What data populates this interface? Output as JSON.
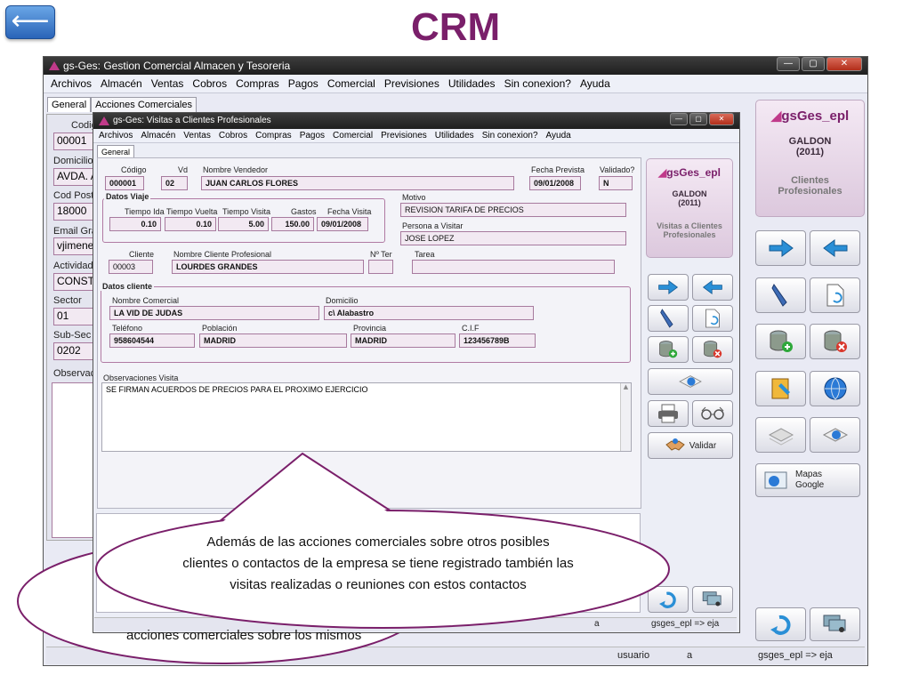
{
  "slide": {
    "title": "CRM",
    "back_label": "⟵"
  },
  "main_window": {
    "title": "gs-Ges: Gestion Comercial Almacen y Tesoreria",
    "menu": [
      "Archivos",
      "Almacén",
      "Ventas",
      "Cobros",
      "Compras",
      "Pagos",
      "Comercial",
      "Previsiones",
      "Utilidades",
      "Sin conexion?",
      "Ayuda"
    ],
    "tabs": [
      "General",
      "Acciones Comerciales"
    ],
    "left_fields": [
      {
        "label": "Codig",
        "value": "00001"
      },
      {
        "label": "Domicilio",
        "value": "AVDA. A"
      },
      {
        "label": "Cod Posta",
        "value": "18000"
      },
      {
        "label": "Email Gra",
        "value": "vjimene"
      },
      {
        "label": "Actividad",
        "value": "CONST"
      },
      {
        "label": "Sector",
        "value": "01"
      },
      {
        "label": "Sub-Sec",
        "value": "0202"
      },
      {
        "label": "Observac",
        "value": ""
      }
    ],
    "brand": {
      "name": "gsGes_epl",
      "company": "GALDON",
      "year": "(2011)",
      "caption": "Clientes Profesionales"
    },
    "maps_button": "Mapas Google",
    "status": {
      "user_label": "usuario",
      "user": "a",
      "session": "gsges_epl => eja"
    }
  },
  "dialog": {
    "title": "gs-Ges: Visitas a Clientes Profesionales",
    "menu": [
      "Archivos",
      "Almacén",
      "Ventas",
      "Cobros",
      "Compras",
      "Pagos",
      "Comercial",
      "Previsiones",
      "Utilidades",
      "Sin conexion?",
      "Ayuda"
    ],
    "tab": "General",
    "labels": {
      "codigo": "Código",
      "vd": "Vd",
      "vendedor": "Nombre Vendedor",
      "fecha_prevista": "Fecha Prevista",
      "validado": "Validado?",
      "datos_viaje": "Datos Viaje",
      "tiempo_ida": "Tiempo Ida",
      "tiempo_vuelta": "Tiempo Vuelta",
      "tiempo_visita": "Tiempo Visita",
      "gastos": "Gastos",
      "fecha_visita": "Fecha Visita",
      "motivo": "Motivo",
      "persona": "Persona a Visitar",
      "cliente": "Cliente",
      "nombre_cliente": "Nombre Cliente Profesional",
      "n_ter": "Nº Ter",
      "tarea": "Tarea",
      "datos_cliente": "Datos cliente",
      "nombre_comercial": "Nombre Comercial",
      "domicilio": "Domicilio",
      "telefono": "Teléfono",
      "poblacion": "Población",
      "provincia": "Provincia",
      "cif": "C.I.F",
      "observaciones": "Observaciones Visita"
    },
    "values": {
      "codigo": "000001",
      "vd": "02",
      "vendedor": "JUAN CARLOS FLORES",
      "fecha_prevista": "09/01/2008",
      "validado": "N",
      "tiempo_ida": "0.10",
      "tiempo_vuelta": "0.10",
      "tiempo_visita": "5.00",
      "gastos": "150.00",
      "fecha_visita": "09/01/2008",
      "motivo": "REVISION TARIFA DE PRECIOS",
      "persona": "JOSE LOPEZ",
      "cliente": "00003",
      "nombre_cliente": "LOURDES GRANDES",
      "n_ter": "",
      "tarea": "",
      "nombre_comercial": "LA VID DE JUDAS",
      "domicilio": "c\\ Alabastro",
      "telefono": "958604544",
      "poblacion": "MADRID",
      "provincia": "MADRID",
      "cif": "123456789B",
      "observaciones": "SE FIRMAN ACUERDOS DE PRECIOS PARA EL PROXIMO EJERCICIO"
    },
    "brand": {
      "name": "gsGes_epl",
      "company": "GALDON",
      "year": "(2011)",
      "caption": "Visitas a Clientes Profesionales"
    },
    "validar_label": "Validar",
    "status": {
      "user": "a",
      "session": "gsges_epl => eja"
    }
  },
  "callout": {
    "text": "Además de las acciones comerciales sobre otros posibles clientes o contactos de la empresa se tiene registrado también las visitas realizadas o reuniones con estos contactos",
    "under_text": "acciones comerciales sobre los mismos"
  },
  "colors": {
    "brand": "#7a1f6a",
    "field_bg": "#f2e9f2",
    "field_border": "#a77a9e",
    "arrow_blue": "#2a8fd6"
  }
}
